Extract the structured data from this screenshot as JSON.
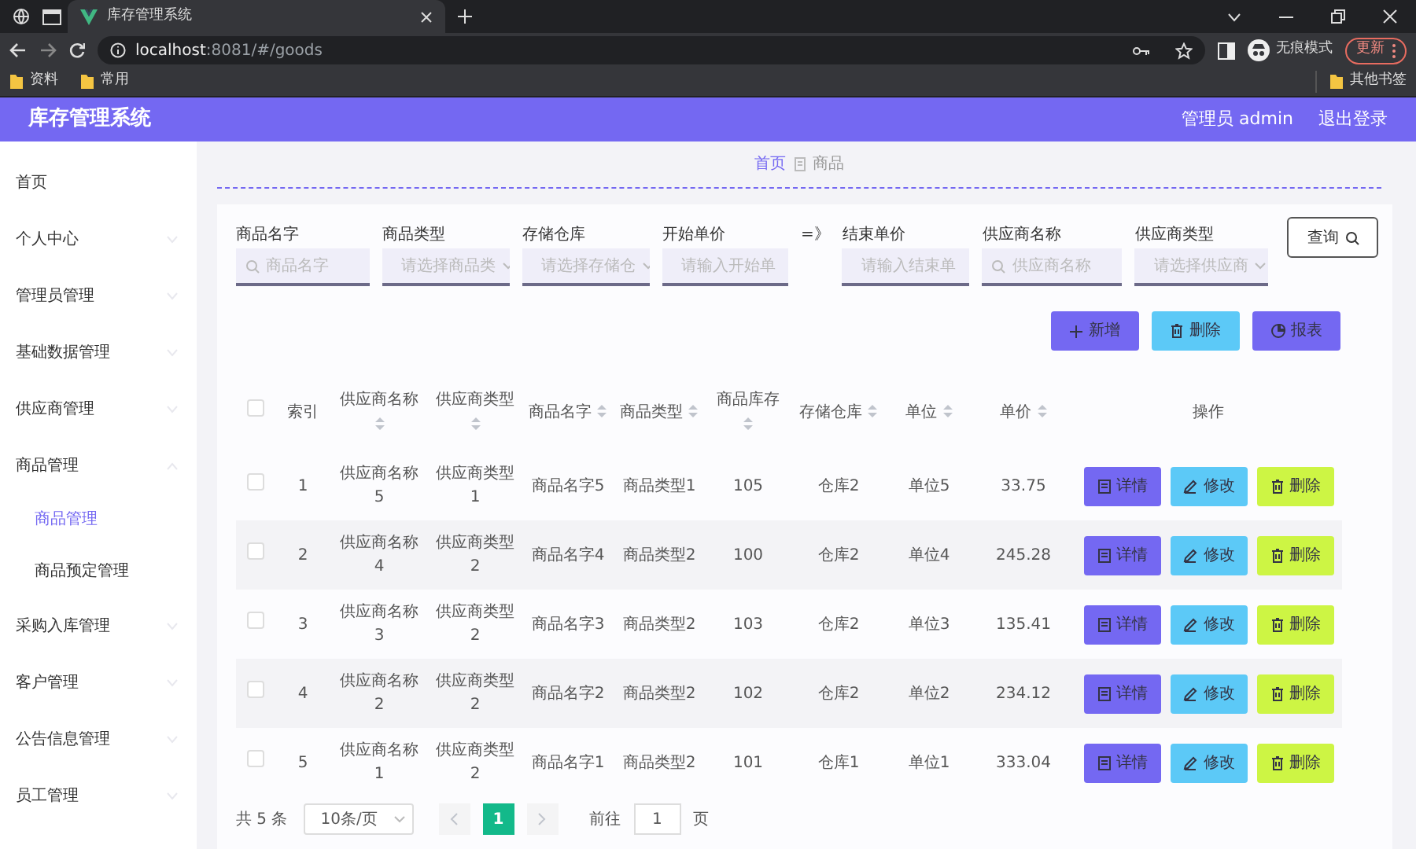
{
  "browser": {
    "tab_title": "库存管理系统",
    "url_host": "localhost",
    "url_rest": ":8081/#/goods",
    "incognito_label": "无痕模式",
    "update_label": "更新",
    "bookmarks": [
      "资料",
      "常用"
    ],
    "other_bookmarks": "其他书签"
  },
  "app": {
    "title": "库存管理系统",
    "user": "管理员 admin",
    "logout": "退出登录"
  },
  "sidebar": {
    "items": [
      {
        "label": "首页",
        "has_children": false,
        "selected": false
      },
      {
        "label": "个人中心",
        "has_children": true,
        "expanded": false,
        "selected": false
      },
      {
        "label": "管理员管理",
        "has_children": true,
        "expanded": false,
        "selected": false
      },
      {
        "label": "基础数据管理",
        "has_children": true,
        "expanded": false,
        "selected": false
      },
      {
        "label": "供应商管理",
        "has_children": true,
        "expanded": false,
        "selected": false
      },
      {
        "label": "商品管理",
        "has_children": true,
        "expanded": true,
        "selected": false,
        "children": [
          {
            "label": "商品管理",
            "selected": true
          },
          {
            "label": "商品预定管理",
            "selected": false
          }
        ]
      },
      {
        "label": "采购入库管理",
        "has_children": true,
        "expanded": false,
        "selected": false
      },
      {
        "label": "客户管理",
        "has_children": true,
        "expanded": false,
        "selected": false
      },
      {
        "label": "公告信息管理",
        "has_children": true,
        "expanded": false,
        "selected": false
      },
      {
        "label": "员工管理",
        "has_children": true,
        "expanded": false,
        "selected": false
      }
    ]
  },
  "breadcrumb": [
    "首页",
    "商品"
  ],
  "filters": [
    {
      "kind": "search",
      "label": "商品名字",
      "placeholder": "商品名字"
    },
    {
      "kind": "select",
      "label": "商品类型",
      "placeholder": "请选择商品类"
    },
    {
      "kind": "select",
      "label": "存储仓库",
      "placeholder": "请选择存储仓"
    },
    {
      "kind": "input",
      "label": "开始单价",
      "placeholder": "请输入开始单"
    },
    {
      "kind": "separator",
      "label": "=》"
    },
    {
      "kind": "input",
      "label": "结束单价",
      "placeholder": "请输入结束单"
    },
    {
      "kind": "search",
      "label": "供应商名称",
      "placeholder": "供应商名称"
    },
    {
      "kind": "select",
      "label": "供应商类型",
      "placeholder": "请选择供应商"
    }
  ],
  "query_button": "查询",
  "toolbar": [
    {
      "kind": "add",
      "label": "新增"
    },
    {
      "kind": "delete",
      "label": "删除"
    },
    {
      "kind": "report",
      "label": "报表"
    }
  ],
  "table": {
    "select_all_checked": false,
    "columns": [
      {
        "label": "索引",
        "sortable": false
      },
      {
        "label": "供应商名称",
        "sortable": true
      },
      {
        "label": "供应商类型",
        "sortable": true
      },
      {
        "label": "商品名字",
        "sortable": true
      },
      {
        "label": "商品类型",
        "sortable": true
      },
      {
        "label": "商品库存",
        "sortable": true
      },
      {
        "label": "存储仓库",
        "sortable": true
      },
      {
        "label": "单位",
        "sortable": true
      },
      {
        "label": "单价",
        "sortable": true
      },
      {
        "label": "操作",
        "sortable": false
      }
    ],
    "rows": [
      {
        "checked": false,
        "cells": [
          "1",
          "供应商名称5",
          "供应商类型1",
          "商品名字5",
          "商品类型1",
          "105",
          "仓库2",
          "单位5",
          "33.75"
        ],
        "actions": [
          {
            "kind": "detail",
            "label": "详情"
          },
          {
            "kind": "edit",
            "label": "修改"
          },
          {
            "kind": "delete",
            "label": "删除"
          }
        ]
      },
      {
        "checked": false,
        "cells": [
          "2",
          "供应商名称4",
          "供应商类型2",
          "商品名字4",
          "商品类型2",
          "100",
          "仓库2",
          "单位4",
          "245.28"
        ],
        "actions": [
          {
            "kind": "detail",
            "label": "详情"
          },
          {
            "kind": "edit",
            "label": "修改"
          },
          {
            "kind": "delete",
            "label": "删除"
          }
        ]
      },
      {
        "checked": false,
        "cells": [
          "3",
          "供应商名称3",
          "供应商类型2",
          "商品名字3",
          "商品类型2",
          "103",
          "仓库2",
          "单位3",
          "135.41"
        ],
        "actions": [
          {
            "kind": "detail",
            "label": "详情"
          },
          {
            "kind": "edit",
            "label": "修改"
          },
          {
            "kind": "delete",
            "label": "删除"
          }
        ]
      },
      {
        "checked": false,
        "cells": [
          "4",
          "供应商名称2",
          "供应商类型2",
          "商品名字2",
          "商品类型2",
          "102",
          "仓库2",
          "单位2",
          "234.12"
        ],
        "actions": [
          {
            "kind": "detail",
            "label": "详情"
          },
          {
            "kind": "edit",
            "label": "修改"
          },
          {
            "kind": "delete",
            "label": "删除"
          }
        ]
      },
      {
        "checked": false,
        "cells": [
          "5",
          "供应商名称1",
          "供应商类型2",
          "商品名字1",
          "商品类型2",
          "101",
          "仓库1",
          "单位1",
          "333.04"
        ],
        "actions": [
          {
            "kind": "detail",
            "label": "详情"
          },
          {
            "kind": "edit",
            "label": "修改"
          },
          {
            "kind": "delete",
            "label": "删除"
          }
        ]
      }
    ]
  },
  "pagination": {
    "total": "共 5 条",
    "page_size": "10条/页",
    "pages": [
      {
        "label": "1",
        "selected": true
      }
    ],
    "goto_label": "前往",
    "goto_value": "1",
    "goto_suffix": "页"
  }
}
